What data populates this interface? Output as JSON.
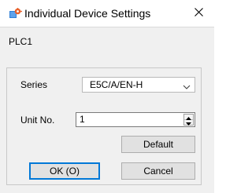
{
  "window": {
    "title": "Individual Device Settings",
    "close_glyph": "✕"
  },
  "device": {
    "name": "PLC1"
  },
  "form": {
    "series_label": "Series",
    "series_value": "E5C/A/EN-H",
    "unit_no_label": "Unit No.",
    "unit_no_value": "1",
    "default_button": "Default"
  },
  "footer": {
    "ok_button": "OK (O)",
    "cancel_button": "Cancel"
  },
  "icons": {
    "title": "settings-device-icon",
    "close": "close-icon",
    "dropdown": "chevron-down-icon",
    "spin_up": "caret-up-icon",
    "spin_down": "caret-down-icon"
  },
  "colors": {
    "accent": "#0078d7",
    "icon_orange": "#e8622c",
    "icon_blue": "#2f7fd6"
  }
}
